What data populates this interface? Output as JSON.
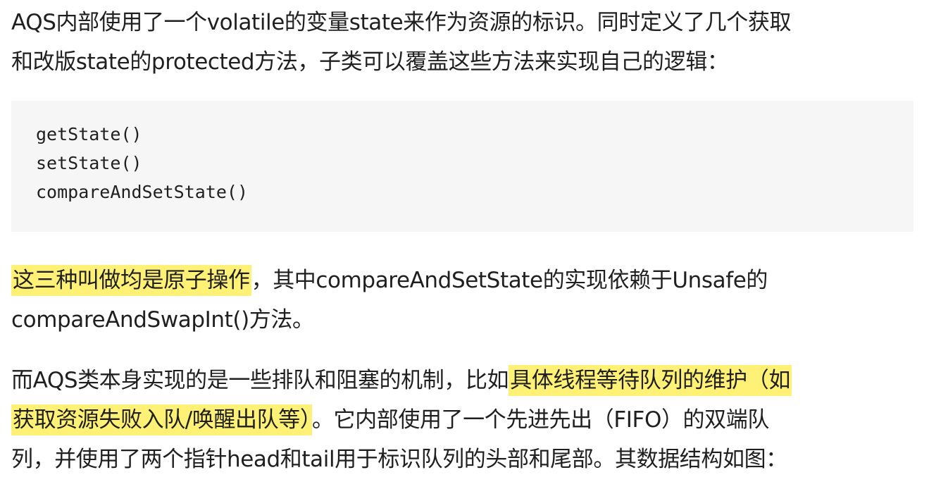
{
  "paragraph1": {
    "line1": "AQS内部使用了一个volatile的变量state来作为资源的标识。同时定义了几个获取",
    "line2": "和改版state的protected方法，子类可以覆盖这些方法来实现自己的逻辑："
  },
  "code": {
    "lines": [
      "getState()",
      "setState()",
      "compareAndSetState()"
    ]
  },
  "paragraph2": {
    "highlight": "这三种叫做均是原子操作",
    "line1_rest": "，其中compareAndSetState的实现依赖于Unsafe的",
    "line2": "compareAndSwapInt()方法。"
  },
  "paragraph3": {
    "line1_start": "而AQS类本身实现的是一些排队和阻塞的机制，比如",
    "highlight_line1": "具体线程等待队列的维护（如",
    "highlight_line2": "获取资源失败入队/唤醒出队等）",
    "line2_rest": "。它内部使用了一个先进先出（FIFO）的双端队",
    "line3": "列，并使用了两个指针head和tail用于标识队列的头部和尾部。其数据结构如图："
  },
  "colors": {
    "highlight": "#fff176",
    "code_background": "#f6f6f6",
    "text": "#1f1f1f"
  }
}
